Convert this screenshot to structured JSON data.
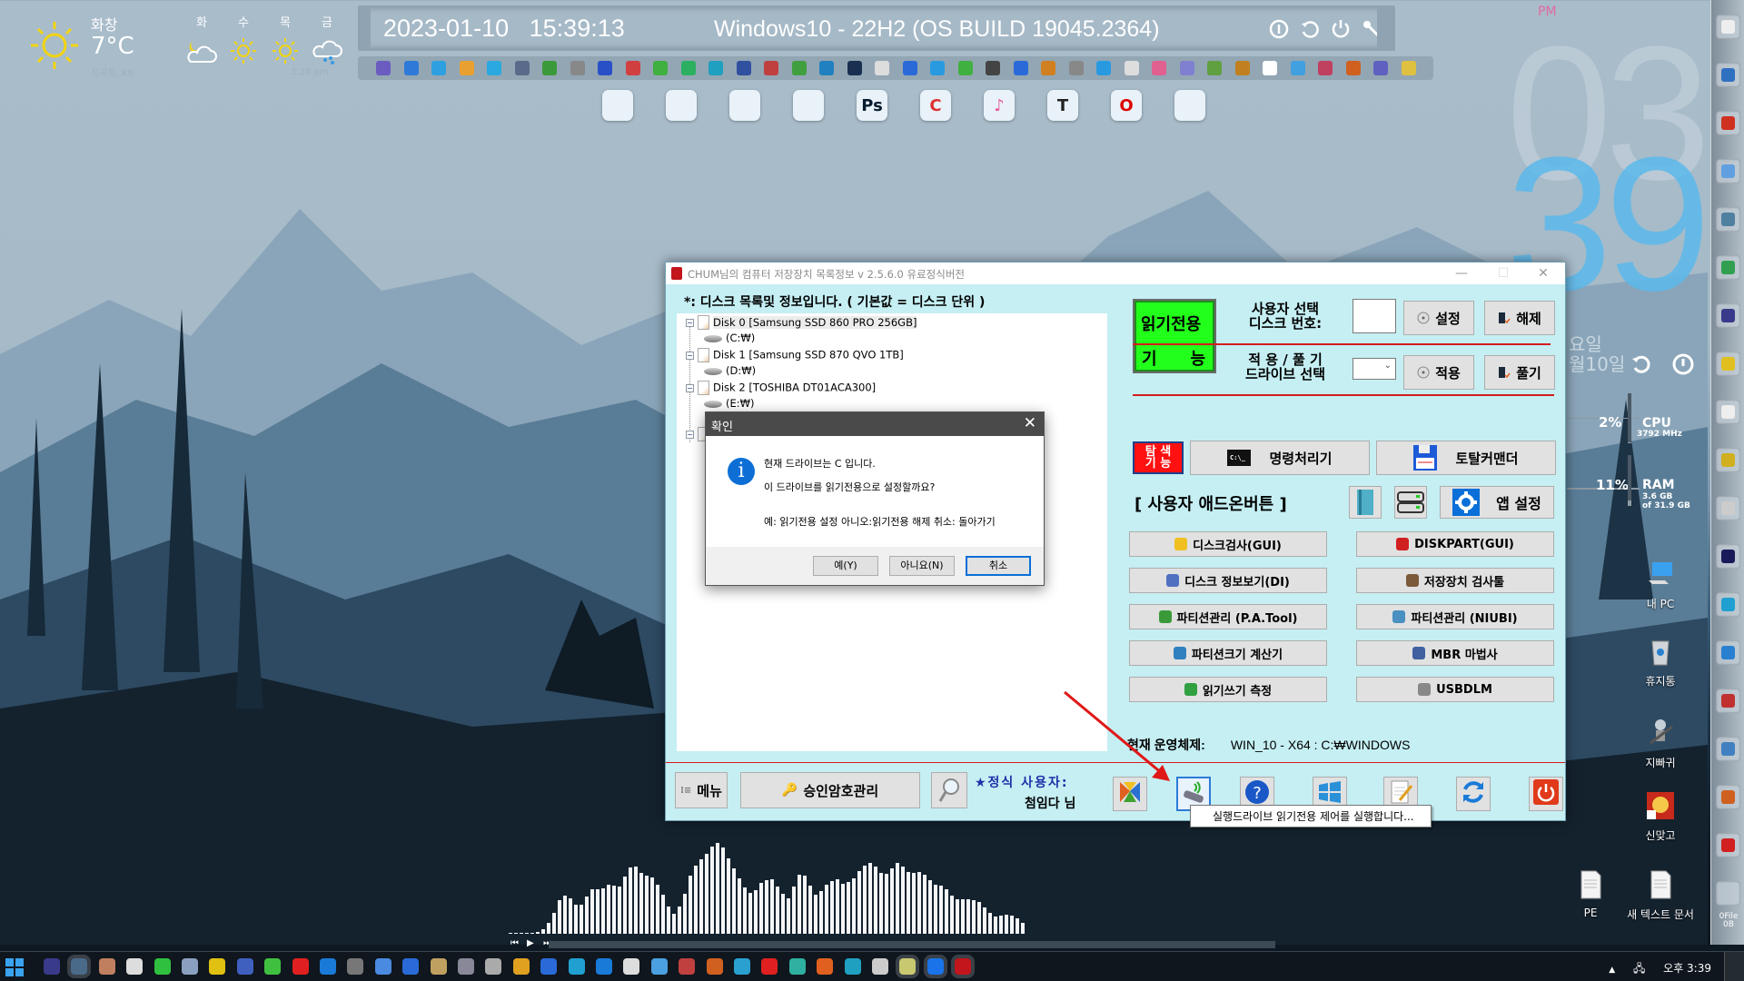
{
  "weather": {
    "city": "화창",
    "temperature": "7°C",
    "location": "신곡동, KR",
    "updated": "3:28 pm",
    "current_icon": "sun-icon",
    "forecast": [
      {
        "day": "화",
        "icon": "moon-cloud-icon"
      },
      {
        "day": "수",
        "icon": "sun-icon"
      },
      {
        "day": "목",
        "icon": "sun-icon"
      },
      {
        "day": "금",
        "icon": "rain-cloud-icon"
      }
    ]
  },
  "topbar": {
    "date": "2023-01-10",
    "time": "15:39:13",
    "os": "Windows10 - 22H2 (OS BUILD 19045.2364)",
    "buttons": [
      "info-icon",
      "restart-icon",
      "power-icon",
      "key-icon"
    ]
  },
  "dock": {
    "apps": [
      "disk-utility",
      "faststone-capture",
      "lightning-app",
      "ccleaner-broom",
      "photoshop",
      "ccleaner",
      "itunes",
      "typora",
      "opera",
      "chrome"
    ],
    "labels": [
      "",
      "",
      "",
      "",
      "Ps",
      "C",
      "♪",
      "T",
      "O",
      ""
    ]
  },
  "clock": {
    "ampm": "PM",
    "hour": "03",
    "minute": "39",
    "weekday": "요일",
    "date": "월10일"
  },
  "meters": {
    "cpu": {
      "label": "CPU",
      "percent": "2%",
      "sub": "3792 MHz",
      "fraction": 0.02
    },
    "ram": {
      "label": "RAM",
      "percent": "11%",
      "sub1": "3.6 GB",
      "sub2": "of 31.9 GB",
      "fraction": 0.11
    }
  },
  "desktop_icons": [
    {
      "label": "내 PC",
      "icon": "pc-icon"
    },
    {
      "label": "휴지통",
      "icon": "recycle-bin-icon"
    },
    {
      "label": "지빠귀",
      "icon": "robot-icon"
    },
    {
      "label": "신맞고",
      "icon": "game-icon"
    },
    {
      "label": "PE",
      "icon": "text-file-icon"
    },
    {
      "label": "새 텍스트 문서",
      "icon": "text-file-icon"
    }
  ],
  "right_dock": {
    "recycle_label": "0File",
    "recycle_sub": "0B"
  },
  "main_window": {
    "title": "CHUM님의 컴퓨터 저장장치 목록정보 v 2.5.6.0 유료정식버전",
    "controls": {
      "minimize": "—",
      "maximize": "☐",
      "close": "✕"
    },
    "disk_header": "*: 디스크 목록및 정보입니다. ( 기본값 = 디스크 단위 )",
    "tree": [
      {
        "disk": "Disk 0 [Samsung SSD 860 PRO 256GB]",
        "drive": "(C:₩)",
        "selected": true
      },
      {
        "disk": "Disk 1 [Samsung SSD 870 QVO 1TB]",
        "drive": "(D:₩)",
        "selected": false
      },
      {
        "disk": "Disk 2 [TOSHIBA DT01ACA300]",
        "drive": "(E:₩)",
        "selected": false
      }
    ],
    "readonly_button": {
      "line1": "읽기전용",
      "line2a": "기",
      "line2b": "능"
    },
    "disk_select_label": "사용자 선택\n디스크 번호:",
    "disk_number_value": "",
    "set_button": "설정",
    "release_button": "해제",
    "drive_select_label": "적 용 / 풀 기\n드라이브 선택",
    "drive_select_value": "",
    "apply_button": "적용",
    "unapply_button": "풀기",
    "search_button": "탐 색\n기 능",
    "cmd_button": "명령처리기",
    "totalcmd_button": "토탈커맨더",
    "addon_title": "[ 사용자 애드온버튼 ]",
    "app_settings_button": "앱 설정",
    "addons": [
      {
        "label": "디스크검사(GUI)",
        "icon": "warning-disk-icon"
      },
      {
        "label": "DISKPART(GUI)",
        "icon": "diskpart-icon"
      },
      {
        "label": "디스크 정보보기(DI)",
        "icon": "disk-info-icon"
      },
      {
        "label": "저장장치 검사툴",
        "icon": "storage-tool-icon"
      },
      {
        "label": "파티션관리 (P.A.Tool)",
        "icon": "partition-assistant-icon"
      },
      {
        "label": "파티션관리 (NIUBI)",
        "icon": "niubi-icon"
      },
      {
        "label": "파티션크기 계산기",
        "icon": "puzzle-icon"
      },
      {
        "label": "MBR 마법사",
        "icon": "wand-icon"
      },
      {
        "label": "읽기쓰기 측정",
        "icon": "benchmark-icon"
      },
      {
        "label": "USBDLM",
        "icon": "usb-drive-icon"
      }
    ],
    "os_label": "현재 운영체제:",
    "os_value": "WIN_10 - X64 : C:₩WINDOWS",
    "menu_button": "메뉴",
    "password_button": "승인암호관리",
    "user_label": "★정식 사용자:",
    "user_name": "첨임다 님",
    "toolbar_icons": [
      "office-icon",
      "usb-readonly-icon",
      "help-icon",
      "windows-icon",
      "notepad-icon",
      "refresh-icon",
      "power-icon"
    ],
    "tooltip": "실행드라이브 읽기전용 제어를 실행합니다..."
  },
  "dialog": {
    "title": "확인",
    "line1": "현재 드라이브는  C  입니다.",
    "line2": "이 드라이브를 읽기전용으로 설정할까요?",
    "line3": "예: 읽기전용 설정   아니오:읽기전용 해제   취소: 돌아가기",
    "yes": "예(Y)",
    "no": "아니요(N)",
    "cancel": "취소"
  },
  "visualizer": {
    "levels": [
      0.01,
      0.01,
      0.01,
      0.01,
      0.01,
      0.02,
      0.05,
      0.12,
      0.23,
      0.37,
      0.42,
      0.39,
      0.32,
      0.32,
      0.41,
      0.49,
      0.49,
      0.5,
      0.54,
      0.53,
      0.52,
      0.63,
      0.73,
      0.74,
      0.67,
      0.64,
      0.62,
      0.54,
      0.43,
      0.3,
      0.22,
      0.3,
      0.44,
      0.64,
      0.75,
      0.82,
      0.88,
      0.96,
      1.0,
      0.95,
      0.83,
      0.72,
      0.61,
      0.51,
      0.45,
      0.48,
      0.56,
      0.59,
      0.6,
      0.52,
      0.44,
      0.39,
      0.52,
      0.65,
      0.64,
      0.53,
      0.43,
      0.47,
      0.54,
      0.58,
      0.6,
      0.55,
      0.57,
      0.61,
      0.69,
      0.75,
      0.78,
      0.74,
      0.67,
      0.66,
      0.72,
      0.78,
      0.74,
      0.68,
      0.67,
      0.68,
      0.65,
      0.59,
      0.54,
      0.53,
      0.49,
      0.42,
      0.38,
      0.38,
      0.38,
      0.37,
      0.35,
      0.29,
      0.23,
      0.19,
      0.2,
      0.21,
      0.2,
      0.17,
      0.12
    ]
  },
  "taskbar": {
    "clock": "오후 3:39",
    "apps_count": 33
  }
}
